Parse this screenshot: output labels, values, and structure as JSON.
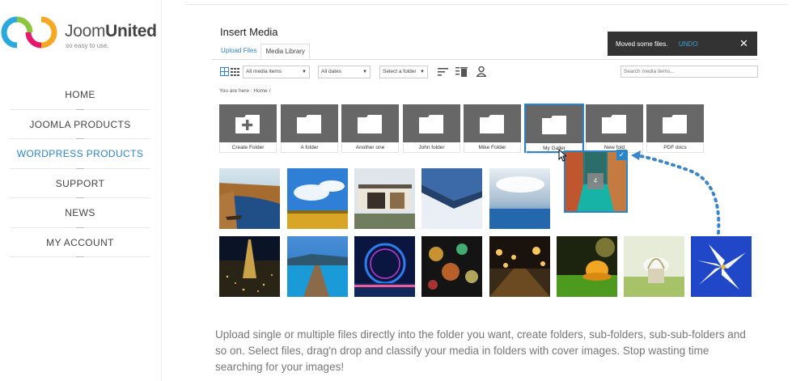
{
  "brand": {
    "name_light": "Joom",
    "name_bold": "United",
    "tagline": "so easy to use."
  },
  "nav": {
    "items": [
      {
        "label": "HOME"
      },
      {
        "label": "JOOMLA PRODUCTS"
      },
      {
        "label": "WORDPRESS PRODUCTS",
        "active": true
      },
      {
        "label": "SUPPORT"
      },
      {
        "label": "NEWS"
      },
      {
        "label": "MY ACCOUNT"
      }
    ]
  },
  "modal": {
    "title": "Insert Media",
    "tabs": [
      {
        "label": "Upload Files"
      },
      {
        "label": "Media Library",
        "active": true
      }
    ]
  },
  "toast": {
    "message": "Moved some files.",
    "undo": "UNDO",
    "close": "✕"
  },
  "toolbar": {
    "filter_media": "All media items",
    "filter_dates": "All dates",
    "filter_folder": "Select a folder",
    "search_placeholder": "Search media items..."
  },
  "breadcrumb": {
    "prefix": "You are here :",
    "home": "Home",
    "separator": "/"
  },
  "folders": [
    {
      "label": "Create Folder",
      "icon": "plus-folder-icon"
    },
    {
      "label": "A folder",
      "icon": "folder-icon"
    },
    {
      "label": "Another one",
      "icon": "folder-icon"
    },
    {
      "label": "John folder",
      "icon": "folder-icon"
    },
    {
      "label": "Mike Folder",
      "icon": "folder-icon"
    },
    {
      "label": "My Galler",
      "icon": "folder-icon",
      "hover": true
    },
    {
      "label": "New fold",
      "icon": "folder-icon"
    },
    {
      "label": "PDF docs",
      "icon": "folder-icon"
    }
  ],
  "drag": {
    "count": "4",
    "check": "✓"
  },
  "thumbnails": [
    {
      "name": "river-thumb"
    },
    {
      "name": "wheat-field-thumb"
    },
    {
      "name": "modern-house-thumb"
    },
    {
      "name": "snowy-mountain-thumb"
    },
    {
      "name": "ocean-storm-thumb"
    },
    {
      "name": "eiffel-night-thumb"
    },
    {
      "name": "pier-lake-thumb"
    },
    {
      "name": "ferris-wheel-thumb"
    },
    {
      "name": "city-bokeh-thumb"
    },
    {
      "name": "street-lights-thumb"
    },
    {
      "name": "grass-hat-thumb"
    },
    {
      "name": "flower-basket-thumb"
    },
    {
      "name": "white-lily-thumb"
    }
  ],
  "description": "Upload single or multiple files directly into the folder you want, create folders, sub-folders, sub-sub-folders and so on. Select files, drag'n drop and classify your media in folders with cover images. Stop wasting time searching for your images!",
  "colors": {
    "accent": "#2a84c7",
    "toast_bg": "#333333",
    "folder_bg": "#676767"
  }
}
